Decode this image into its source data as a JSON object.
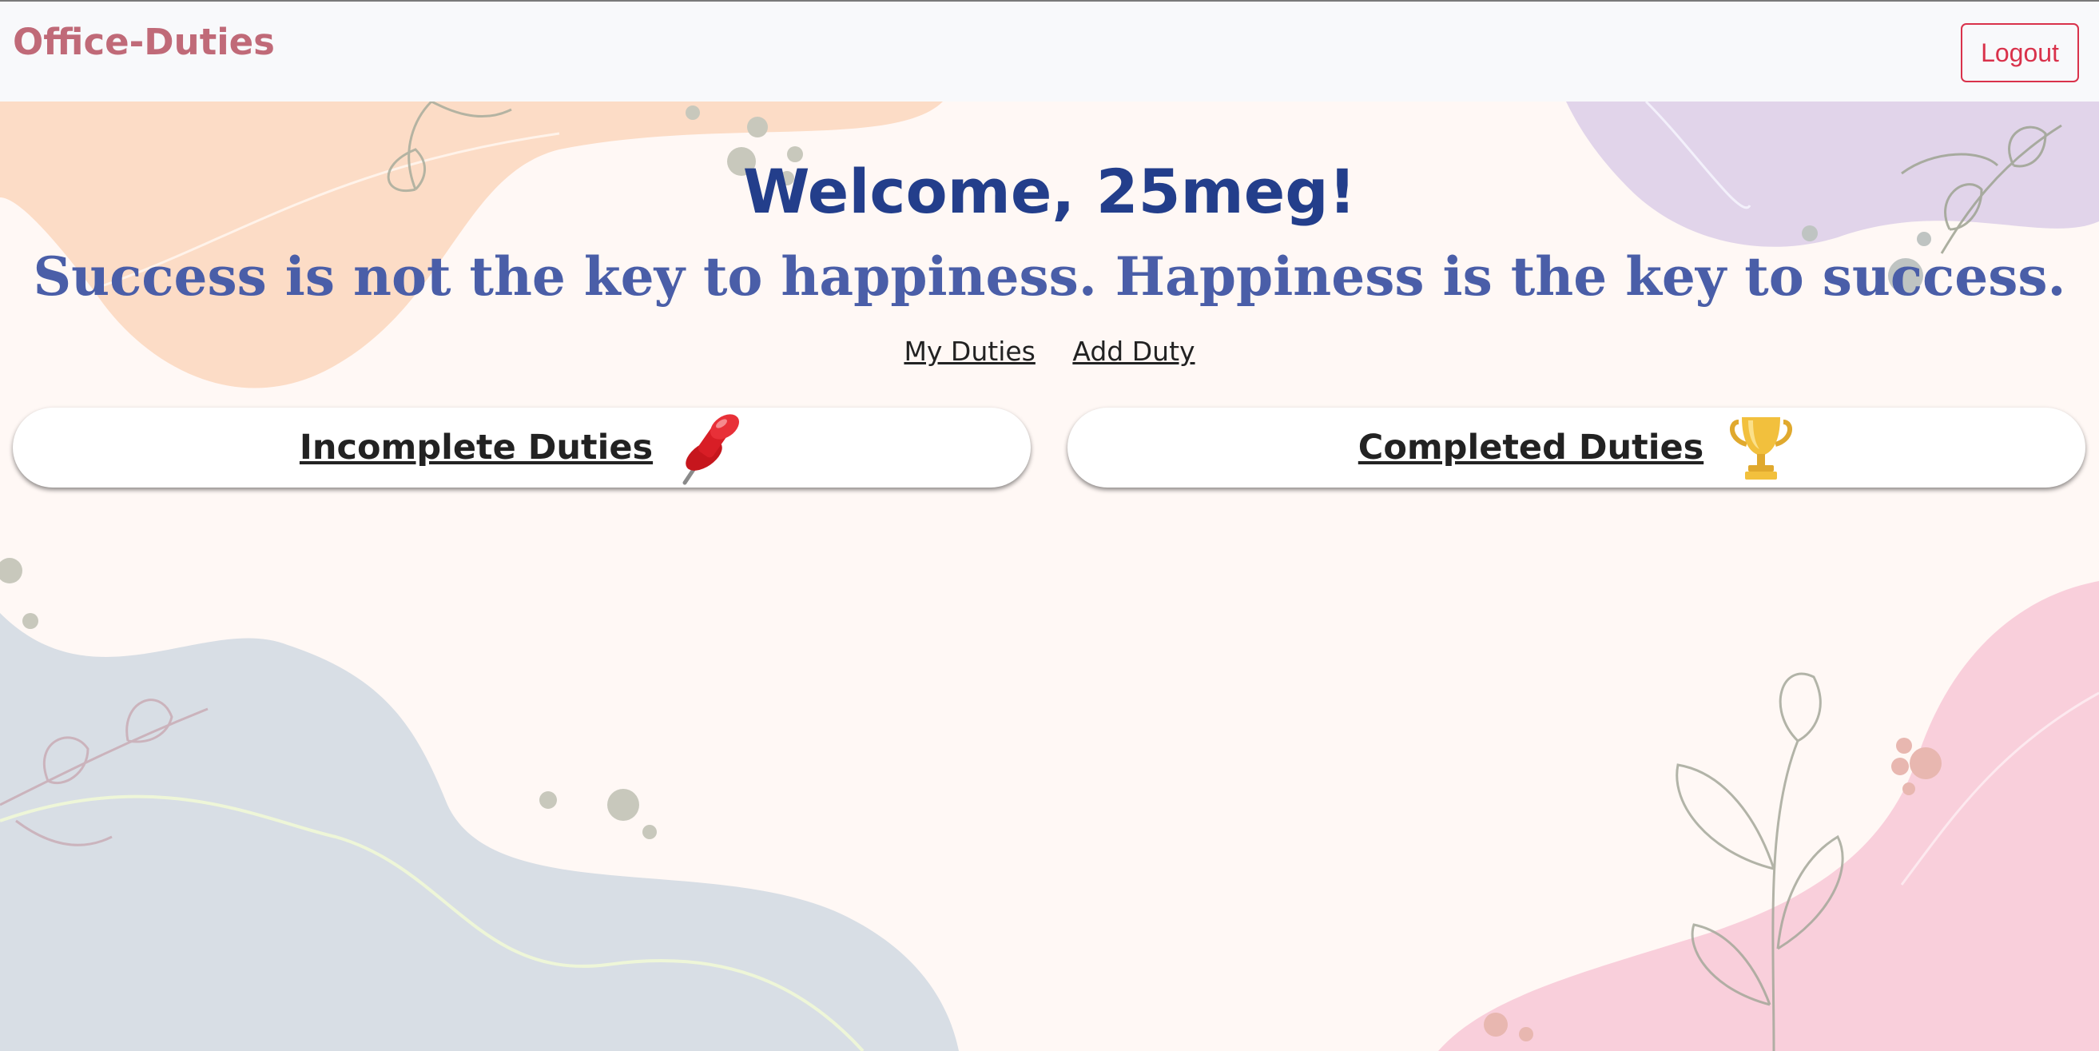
{
  "navbar": {
    "brand": "Office-Duties",
    "logout_label": "Logout"
  },
  "main": {
    "welcome": "Welcome, 25meg!",
    "quote": "Success is not the key to happiness. Happiness is the key to success.",
    "links": [
      {
        "label": "My Duties"
      },
      {
        "label": "Add Duty"
      }
    ],
    "cards": [
      {
        "title": "Incomplete Duties",
        "icon": "pushpin-icon"
      },
      {
        "title": "Completed Duties",
        "icon": "trophy-icon"
      }
    ]
  },
  "colors": {
    "brand": "#c06a78",
    "welcome": "#233e8b",
    "quote": "#4a5ea8",
    "logout": "#d9324b",
    "page_bg": "#fff8f5",
    "navbar_bg": "#f8f9fb"
  }
}
